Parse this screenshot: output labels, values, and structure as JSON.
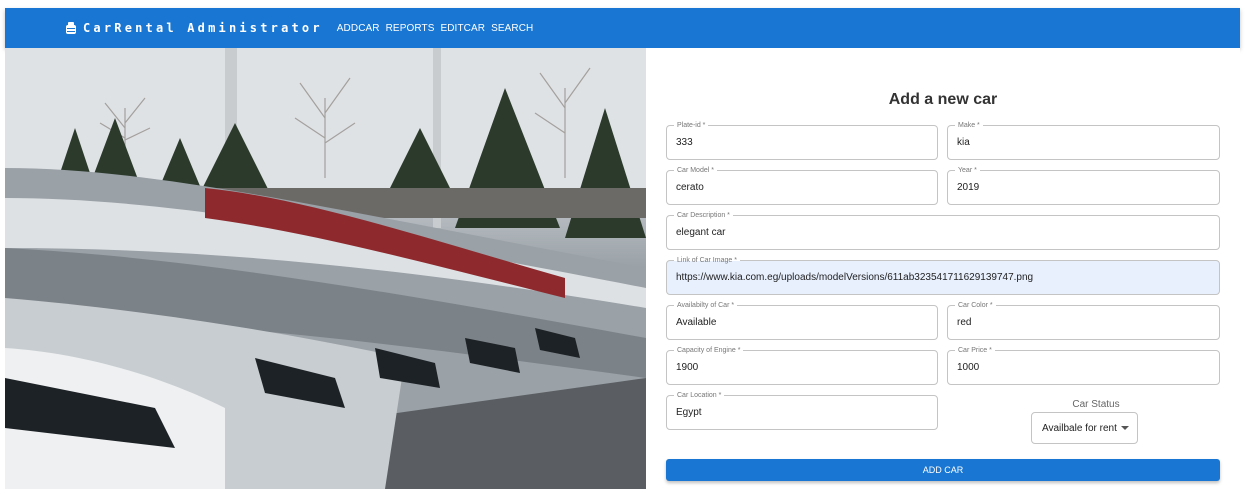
{
  "appbar": {
    "brand": "CarRental Administrator",
    "nav": [
      "ADDCAR",
      "REPORTS",
      "EDITCAR",
      "SEARCH"
    ]
  },
  "form": {
    "title": "Add a new car",
    "fields": {
      "plate_id": {
        "label": "Plate-id *",
        "value": "333"
      },
      "make": {
        "label": "Make *",
        "value": "kia"
      },
      "car_model": {
        "label": "Car Model *",
        "value": "cerato"
      },
      "year": {
        "label": "Year *",
        "value": "2019"
      },
      "car_description": {
        "label": "Car Description *",
        "value": "elegant car"
      },
      "car_image": {
        "label": "Link of Car Image *",
        "value": "https://www.kia.com.eg/uploads/modelVersions/611ab323541711629139747.png"
      },
      "availability": {
        "label": "Availabilty of Car *",
        "value": "Available"
      },
      "car_color": {
        "label": "Car Color *",
        "value": "red"
      },
      "engine_capacity": {
        "label": "Capacity of Engine *",
        "value": "1900"
      },
      "car_price": {
        "label": "Car Price *",
        "value": "1000"
      },
      "car_location": {
        "label": "Car Location *",
        "value": "Egypt"
      }
    },
    "status": {
      "label": "Car Status",
      "selected": "Availbale for rent"
    },
    "submit_label": "ADD CAR"
  },
  "colors": {
    "primary": "#1976d2",
    "autofill": "#e8f0fe"
  }
}
